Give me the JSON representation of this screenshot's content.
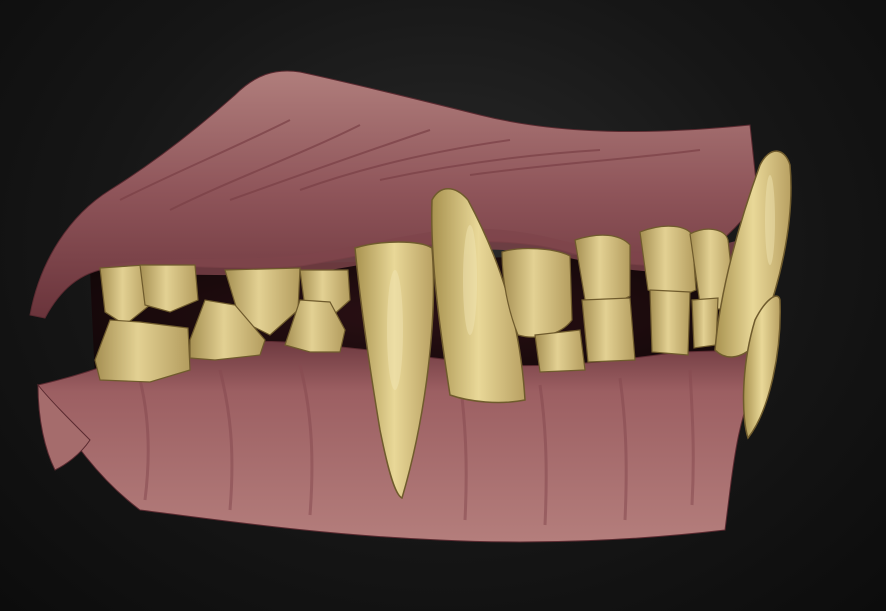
{
  "scene": {
    "subject": "teeth-and-gums-model",
    "colors": {
      "background": "#141414",
      "gum": "#9a5a5e",
      "gum_dark": "#6e3a40",
      "gum_light": "#b87a78",
      "tooth": "#d9c585",
      "tooth_shadow": "#a58f52",
      "tooth_highlight": "#eee0a8"
    }
  }
}
